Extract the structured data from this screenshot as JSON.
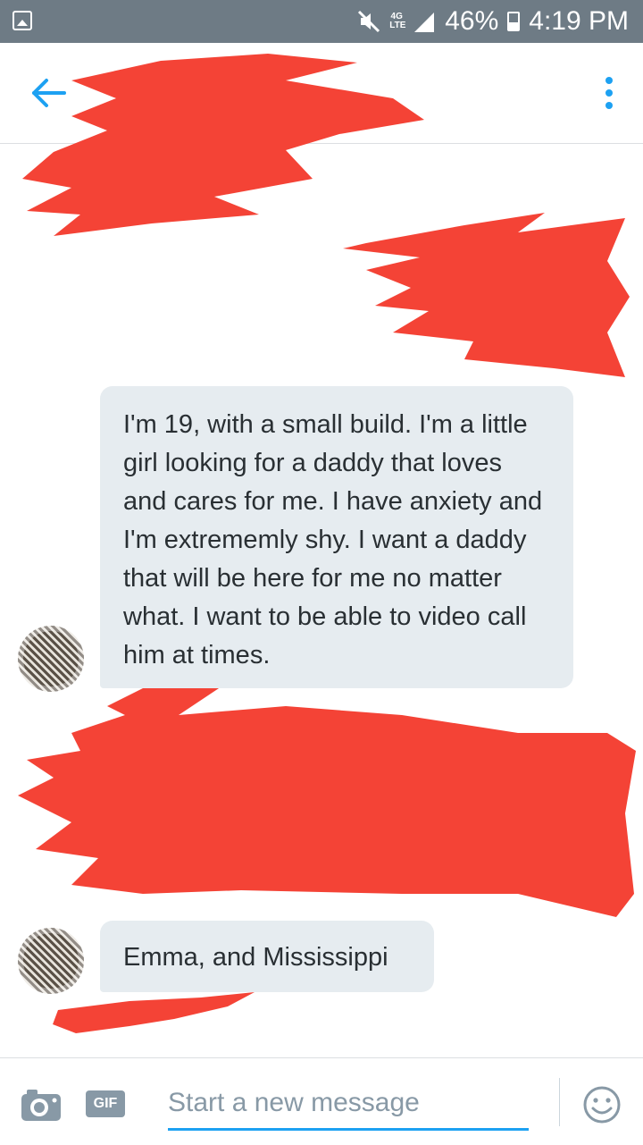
{
  "status_bar": {
    "network": "4G LTE",
    "battery": "46%",
    "battery_level": 0.46,
    "time": "4:19 PM",
    "icons": [
      "gallery-icon",
      "mute-icon",
      "signal-icon",
      "battery-icon"
    ]
  },
  "header": {
    "back_icon": "arrow-left-icon",
    "more_icon": "more-vertical-icon",
    "accent_color": "#1da1f2"
  },
  "redaction_color": "#f44336",
  "messages": [
    {
      "direction": "received",
      "text": "I'm 19, with a small build. I'm a little girl looking for a daddy that loves and cares for me. I have anxiety and I'm extrememly shy. I want a daddy that will be here for me no matter what. I want to be able to video call him at times."
    },
    {
      "direction": "received",
      "text": "Emma, and Mississippi"
    }
  ],
  "composer": {
    "camera_icon": "camera-icon",
    "gif_label": "GIF",
    "placeholder": "Start a new message",
    "emoji_icon": "smiley-icon"
  }
}
